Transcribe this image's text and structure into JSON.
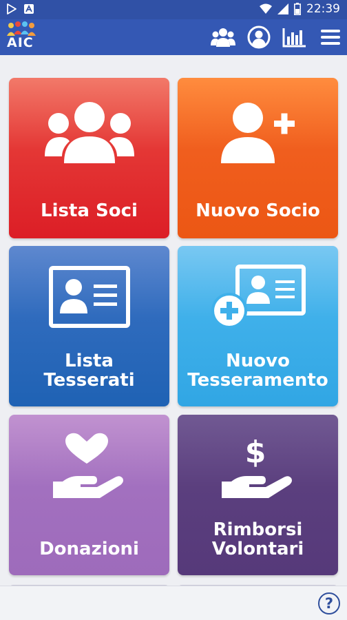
{
  "status_bar": {
    "time": "22:39"
  },
  "app": {
    "logo_text": "AIC"
  },
  "header": {
    "actions": [
      {
        "name": "members-icon"
      },
      {
        "name": "account-icon"
      },
      {
        "name": "chart-icon"
      },
      {
        "name": "menu-icon"
      }
    ]
  },
  "tiles": [
    {
      "label": "Lista Soci",
      "icon": "group-icon"
    },
    {
      "label": "Nuovo Socio",
      "icon": "add-person-icon"
    },
    {
      "label": "Lista\nTesserati",
      "icon": "id-card-icon"
    },
    {
      "label": "Nuovo\nTesseramento",
      "icon": "add-id-card-icon"
    },
    {
      "label": "Donazioni",
      "icon": "heart-hand-icon"
    },
    {
      "label": "Rimborsi\nVolontari",
      "icon": "dollar-hand-icon"
    }
  ],
  "footer": {
    "help_label": "?"
  },
  "colors": {
    "appbar": "#3458b4",
    "statusbar": "#3051a6",
    "red": "#e43735",
    "orange": "#f05e1e",
    "blue": "#2f6bbd",
    "light_blue": "#3fb0ea",
    "lilac": "#a270bf",
    "purple": "#5b3f7e"
  }
}
